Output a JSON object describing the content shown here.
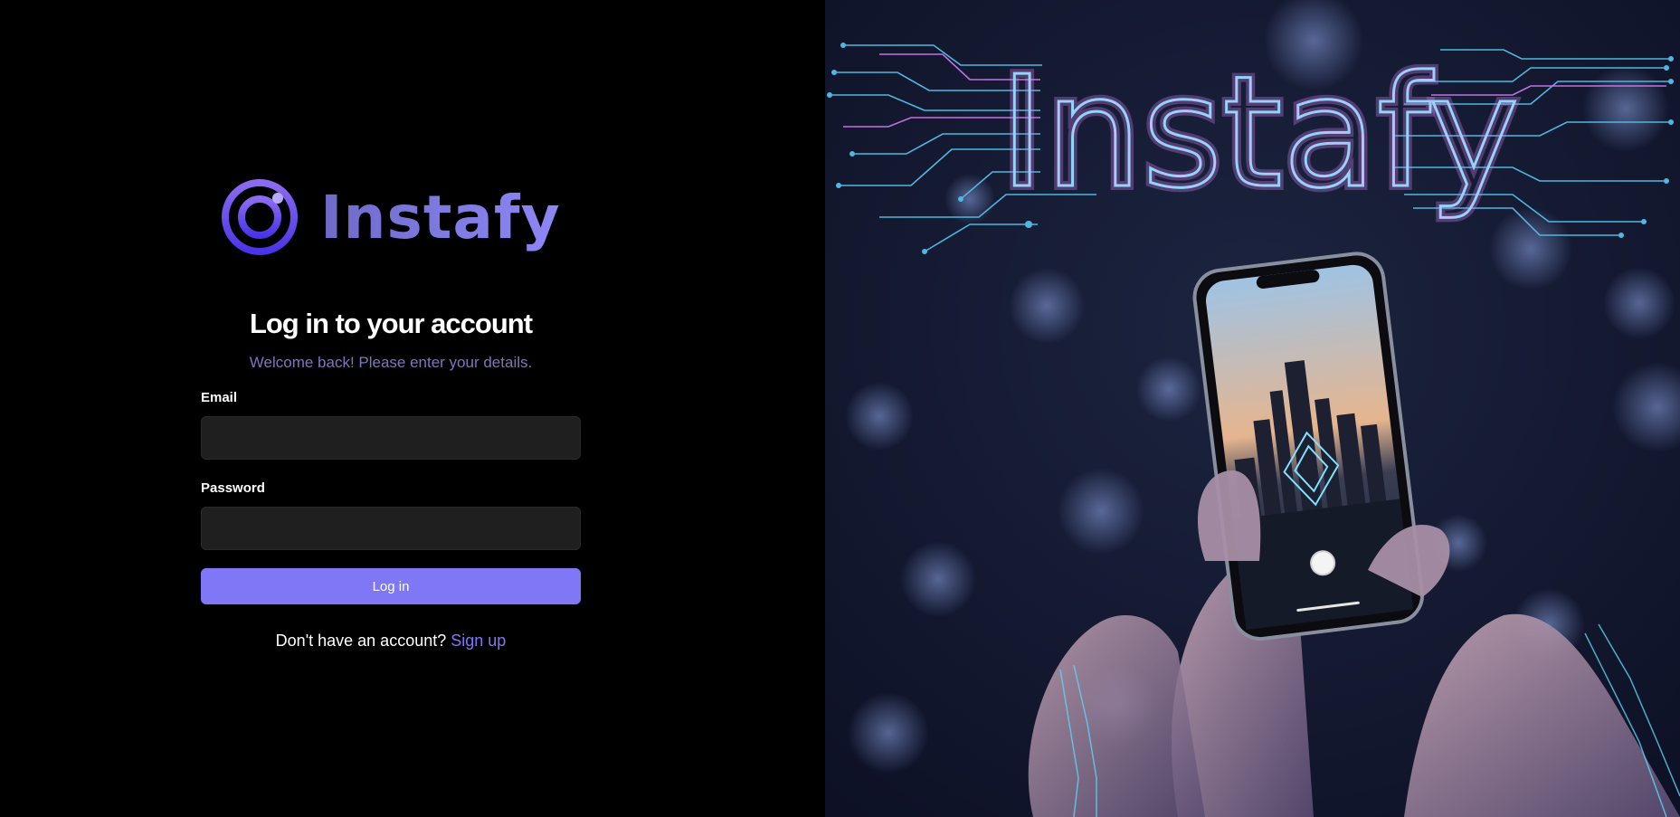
{
  "brand": {
    "name": "Instafy",
    "logo_icon": "camera-ring-icon"
  },
  "login_form": {
    "title": "Log in to your account",
    "subtitle": "Welcome back! Please enter your details.",
    "email_label": "Email",
    "email_value": "",
    "password_label": "Password",
    "password_value": "",
    "submit_label": "Log in"
  },
  "signup": {
    "prompt": "Don't have an account?",
    "link_label": "Sign up"
  },
  "hero": {
    "neon_title": "Instafy",
    "image_subject": "hands-holding-phone-city-camera"
  },
  "colors": {
    "background": "#000000",
    "accent": "#8077f7",
    "input_bg": "#1f1f1f",
    "subtitle": "#7b77c0"
  }
}
